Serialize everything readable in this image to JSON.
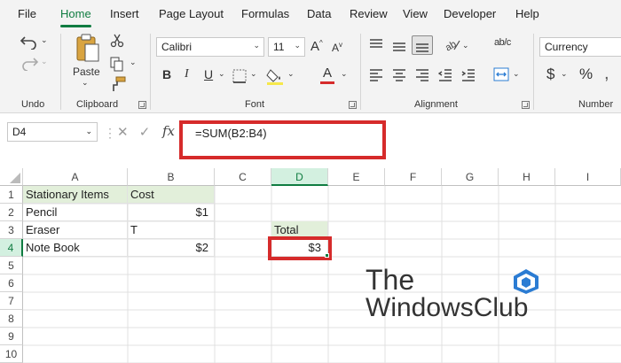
{
  "menu": {
    "tabs": [
      "File",
      "Home",
      "Insert",
      "Page Layout",
      "Formulas",
      "Data",
      "Review",
      "View",
      "Developer",
      "Help"
    ],
    "active": "Home"
  },
  "ribbon": {
    "undo_group": {
      "label": "Undo"
    },
    "clipboard_group": {
      "label": "Clipboard",
      "paste_label": "Paste"
    },
    "font_group": {
      "label": "Font",
      "font_name": "Calibri",
      "font_size": "11",
      "grow_icon": "A",
      "shrink_icon": "A",
      "bold": "B",
      "italic": "I",
      "underline": "U",
      "font_color_letter": "A"
    },
    "alignment_group": {
      "label": "Alignment",
      "wrap_icon": "ab/c"
    },
    "number_group": {
      "label": "Number",
      "format": "Currency",
      "currency_symbol": "$",
      "percent_symbol": "%"
    }
  },
  "formula_bar": {
    "name_box": "D4",
    "formula": "=SUM(B2:B4)",
    "fx": "fx"
  },
  "grid": {
    "columns": [
      "A",
      "B",
      "C",
      "D",
      "E",
      "F",
      "G",
      "H",
      "I"
    ],
    "rows": [
      "1",
      "2",
      "3",
      "4",
      "5",
      "6",
      "7",
      "8",
      "9",
      "10"
    ],
    "selected_column": "D",
    "selected_row": "4",
    "cells": {
      "A1": "Stationary Items",
      "B1": "Cost",
      "A2": "Pencil",
      "B2": "$1",
      "A3": "Eraser",
      "B3": "T",
      "D3": "Total",
      "A4": "Note Book",
      "B4": "$2",
      "D4": "$3"
    }
  },
  "watermark": {
    "line1": "The",
    "line2": "WindowsClub"
  },
  "colors": {
    "accent": "#107c41",
    "highlight": "#d62b2b",
    "header_fill": "#e2efda",
    "logo_blue": "#2b7cd3"
  }
}
